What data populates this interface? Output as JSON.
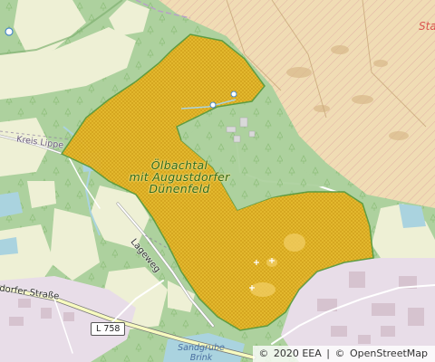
{
  "map": {
    "protected_area": {
      "name": "Ölbachtal mit Augustdorfer Dünenfeld",
      "line1": "Ölbachtal",
      "line2": "mit Augustdorfer",
      "line3": "Dünenfeld",
      "fill_color": "#e6b416",
      "outline_color": "#5b9a3c"
    },
    "labels": {
      "kreis_lippe": "Kreis Lippe",
      "lageweg": "Lageweg",
      "augustdorfer_strasse": "dorfer Straße",
      "route_l758": "L 758",
      "place_partial": "Sta",
      "sandgrube_line1": "Sandgrube",
      "sandgrube_line2": "Brink"
    },
    "colors": {
      "forest": "#add19e",
      "farmland": "#eef0d5",
      "military": "#f0dcb4",
      "residential": "#e8dde8",
      "water": "#aad3df",
      "place_red": "#d9534f"
    },
    "attribution": {
      "copyright": "©",
      "eea": "2020 EEA",
      "separator": "|",
      "osm": "OpenStreetMap"
    }
  }
}
